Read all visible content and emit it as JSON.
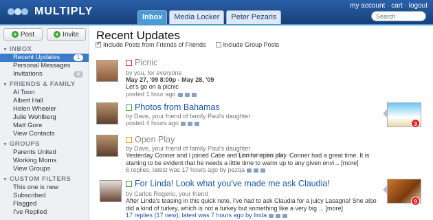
{
  "brand": "MULTIPLY",
  "tabs": [
    "Inbox",
    "Media Locker",
    "Peter Pezaris"
  ],
  "toplinks": "my account · cart · logout",
  "search": {
    "placeholder": "Search"
  },
  "side_buttons": {
    "post": "Post",
    "invite": "Invite"
  },
  "sidebar": {
    "inbox_header": "INBOX",
    "inbox": [
      {
        "label": "Recent Updates",
        "badge": "1"
      },
      {
        "label": "Personal Messages",
        "badge": ""
      },
      {
        "label": "Invitations",
        "badge": "4"
      }
    ],
    "ff_header": "FRIENDS & FAMILY",
    "ff": [
      "Al Toon",
      "Albert Hall",
      "Helen Wheeler",
      "Julie Wohlberg",
      "Matt Gore",
      "View Contacts"
    ],
    "groups_header": "GROUPS",
    "groups": [
      "Parents United",
      "Working Moms",
      "View Groups"
    ],
    "cf_header": "CUSTOM FILTERS",
    "cf": [
      "This one is new",
      "Subscribed",
      "Flagged",
      "I've Replied"
    ]
  },
  "main": {
    "title": "Recent Updates",
    "filter1": "Include Posts from Friends of Friends",
    "filter2": "Include Group Posts",
    "since_visit": "— Since your last visit —"
  },
  "posts": [
    {
      "title": "Picnic",
      "by": "by you, for everyone",
      "date": "May 27, '09 8:00p - May 28, '09",
      "body": "Let's go on a picnic",
      "footer": "posted 1 hour ago"
    },
    {
      "title": "Photos from Bahamas",
      "by": "by Dave, your friend of family Paul's daughter",
      "footer": "posted 4 hours ago",
      "count": "3"
    },
    {
      "title": "Open Play",
      "by": "by Dave, your friend of family Paul's daughter",
      "body": "Yesterday Conner and I joined Catie and Lori for open play. Conner had a great time. It is starting to be evident that he needs a little time to warm up to any given envi... [more]",
      "footer": "6 replies, latest was 17 hours ago by pezqa"
    },
    {
      "title": "For Linda! Look what you've made me ask Claudia!",
      "by": "by Carlos Rogerio, your friend",
      "body": "After Linda's teasing in this quick note, I've had to ask Claudia for a juicy Lasagna! She also did a kind of turkey, which is not a turkey but something like a very big ... [more]",
      "footer": "17 replies (17 new), latest was 7 hours ago by linda",
      "count": "9"
    }
  ]
}
